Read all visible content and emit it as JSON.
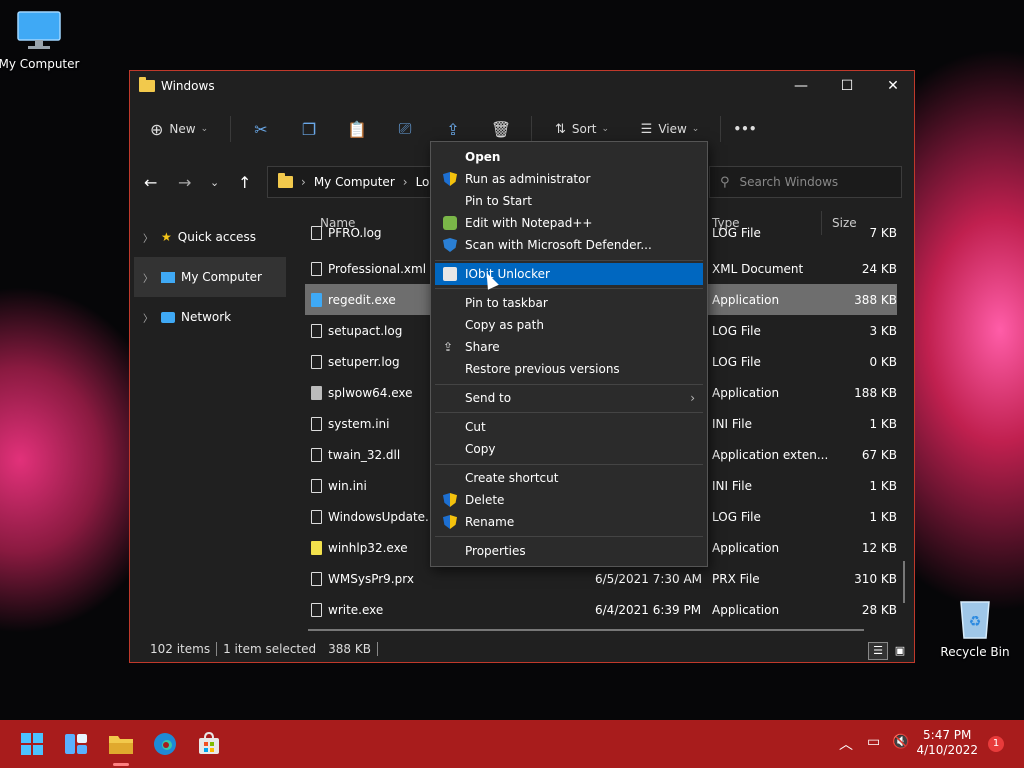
{
  "desktop": {
    "my_computer_label": "My Computer",
    "recycle_bin_label": "Recycle Bin"
  },
  "window": {
    "title": "Windows",
    "buttons": {
      "minimize": "—",
      "maximize": "☐",
      "close": "✕"
    }
  },
  "toolbar": {
    "new_label": "New",
    "sort_label": "Sort",
    "view_label": "View",
    "more_label": "•••"
  },
  "nav": {
    "address_root": "My Computer",
    "address_next": "Loc",
    "search_placeholder": "Search Windows"
  },
  "sidebar": {
    "items": [
      {
        "label": "Quick access"
      },
      {
        "label": "My Computer"
      },
      {
        "label": "Network"
      }
    ]
  },
  "columns": {
    "name": "Name",
    "type": "Type",
    "size": "Size"
  },
  "files": [
    {
      "name": "PFRO.log",
      "date": "",
      "type": "LOG File",
      "size": "7 KB"
    },
    {
      "name": "Professional.xml",
      "date": "",
      "type": "XML Document",
      "size": "24 KB"
    },
    {
      "name": "regedit.exe",
      "date": "",
      "type": "Application",
      "size": "388 KB"
    },
    {
      "name": "setupact.log",
      "date": "",
      "type": "LOG File",
      "size": "3 KB"
    },
    {
      "name": "setuperr.log",
      "date": "",
      "type": "LOG File",
      "size": "0 KB"
    },
    {
      "name": "splwow64.exe",
      "date": "",
      "type": "Application",
      "size": "188 KB"
    },
    {
      "name": "system.ini",
      "date": "",
      "type": "INI File",
      "size": "1 KB"
    },
    {
      "name": "twain_32.dll",
      "date": "",
      "type": "Application exten...",
      "size": "67 KB"
    },
    {
      "name": "win.ini",
      "date": "",
      "type": "INI File",
      "size": "1 KB"
    },
    {
      "name": "WindowsUpdate.log",
      "date": "",
      "type": "LOG File",
      "size": "1 KB"
    },
    {
      "name": "winhlp32.exe",
      "date": "",
      "type": "Application",
      "size": "12 KB"
    },
    {
      "name": "WMSysPr9.prx",
      "date": "6/5/2021 7:30 AM",
      "type": "PRX File",
      "size": "310 KB"
    },
    {
      "name": "write.exe",
      "date": "6/4/2021 6:39 PM",
      "type": "Application",
      "size": "28 KB"
    }
  ],
  "status": {
    "items": "102 items",
    "selected": "1 item selected",
    "size": "388 KB"
  },
  "context_menu": {
    "open": "Open",
    "run_admin": "Run as administrator",
    "pin_start": "Pin to Start",
    "edit_notepad": "Edit with Notepad++",
    "scan_defender": "Scan with Microsoft Defender...",
    "iobit": "IObit Unlocker",
    "pin_taskbar": "Pin to taskbar",
    "copy_path": "Copy as path",
    "share": "Share",
    "restore": "Restore previous versions",
    "send_to": "Send to",
    "cut": "Cut",
    "copy": "Copy",
    "create_shortcut": "Create shortcut",
    "delete": "Delete",
    "rename": "Rename",
    "properties": "Properties"
  },
  "taskbar": {
    "time": "5:47 PM",
    "date": "4/10/2022",
    "notifications": "1"
  },
  "colors": {
    "accent": "#0067c0",
    "taskbar": "#a81c1c",
    "window_border": "#c0392b"
  }
}
